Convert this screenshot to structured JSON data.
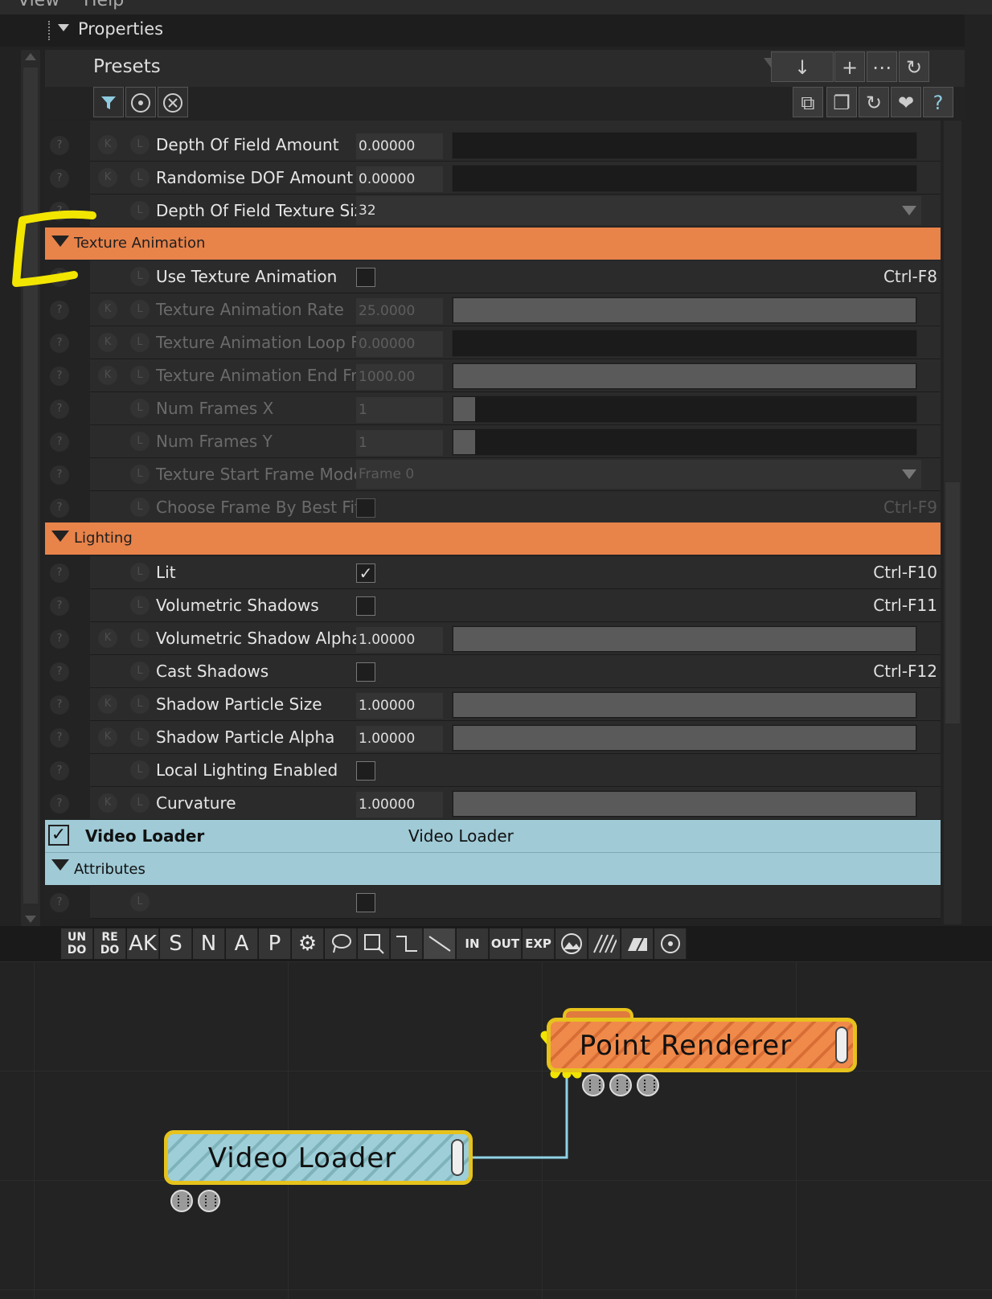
{
  "menubar": {
    "items": [
      "View",
      "Help"
    ]
  },
  "panel": {
    "title": "Properties"
  },
  "presets": {
    "label": "Presets",
    "toolbar_top": [
      "↓",
      "+",
      "⋯",
      "↻"
    ],
    "toolbar_bottom": [
      "⧉",
      "❐",
      "↻",
      "❤",
      "?"
    ],
    "filter_icons": [
      "filter-icon",
      "target-icon",
      "clear-icon"
    ]
  },
  "rows": [
    {
      "name": "Depth Of Field Amount",
      "value": "0.00000",
      "k": true,
      "fill": 0
    },
    {
      "name": "Randomise DOF Amount",
      "value": "0.00000",
      "k": true,
      "fill": 0
    },
    {
      "name": "Depth Of Field Texture Size",
      "value": "32",
      "type": "dropdown"
    }
  ],
  "section_texture": {
    "label": "Texture Animation"
  },
  "texture_rows": [
    {
      "name": "Use Texture Animation",
      "type": "checkbox",
      "checked": false,
      "shortcut": "Ctrl-F8"
    },
    {
      "name": "Texture Animation Rate",
      "value": "25.0000",
      "k": true,
      "fill": 1,
      "dim": true
    },
    {
      "name": "Texture Animation Loop Frame",
      "value": "0.00000",
      "k": true,
      "fill": 0,
      "dim": true
    },
    {
      "name": "Texture Animation End Frame",
      "value": "1000.00",
      "k": true,
      "fill": 1,
      "dim": true
    },
    {
      "name": "Num Frames X",
      "value": "1",
      "fill": 0.05,
      "dim": true
    },
    {
      "name": "Num Frames Y",
      "value": "1",
      "fill": 0.05,
      "dim": true
    },
    {
      "name": "Texture Start Frame Mode",
      "value": "Frame 0",
      "type": "dropdown",
      "dim": true
    },
    {
      "name": "Choose Frame By Best Fit To",
      "type": "checkbox",
      "checked": false,
      "shortcut": "Ctrl-F9",
      "dim": true
    }
  ],
  "section_lighting": {
    "label": "Lighting"
  },
  "lighting_rows": [
    {
      "name": "Lit",
      "type": "checkbox",
      "checked": true,
      "shortcut": "Ctrl-F10"
    },
    {
      "name": "Volumetric Shadows",
      "type": "checkbox",
      "checked": false,
      "shortcut": "Ctrl-F11"
    },
    {
      "name": "Volumetric Shadow Alpha",
      "value": "1.00000",
      "k": true,
      "fill": 1
    },
    {
      "name": "Cast Shadows",
      "type": "checkbox",
      "checked": false,
      "shortcut": "Ctrl-F12"
    },
    {
      "name": "Shadow Particle Size",
      "value": "1.00000",
      "k": true,
      "fill": 1
    },
    {
      "name": "Shadow Particle Alpha",
      "value": "1.00000",
      "k": true,
      "fill": 1
    },
    {
      "name": "Local Lighting Enabled",
      "type": "checkbox",
      "checked": false
    },
    {
      "name": "Curvature",
      "value": "1.00000",
      "k": true,
      "fill": 1
    }
  ],
  "object_header": {
    "name": "Video Loader",
    "type": "Video Loader",
    "checked": true
  },
  "attributes_header": {
    "label": "Attributes"
  },
  "toolbar": {
    "buttons": [
      "UN DO",
      "RE DO",
      "AK",
      "S",
      "N",
      "A",
      "P",
      "⚙",
      "lasso",
      "select",
      "step",
      "line",
      "IN",
      "OUT",
      "EXP",
      "image",
      "hatch",
      "flag",
      "target"
    ]
  },
  "graph": {
    "nodes": [
      {
        "name": "Point Renderer",
        "color": "#f08a4b"
      },
      {
        "name": "Video Loader",
        "color": "#93c3cc"
      }
    ],
    "connection_color": "#8fd3e4"
  },
  "colors": {
    "section_orange": "#e8834a",
    "object_blue": "#9fcad6",
    "annotation_yellow": "#f2e500"
  }
}
